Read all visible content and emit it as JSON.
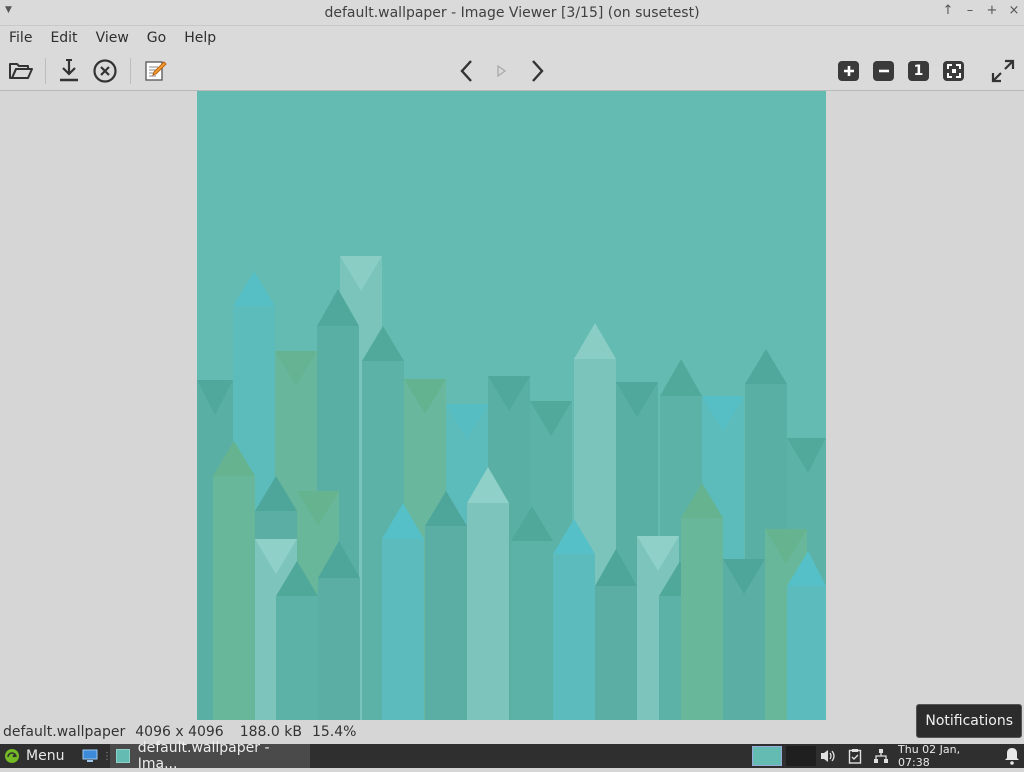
{
  "window": {
    "title": "default.wallpaper - Image Viewer [3/15] (on susetest)",
    "controls": {
      "pin": "↑",
      "minimize": "–",
      "maximize": "+",
      "close": "×"
    }
  },
  "menubar": {
    "items": [
      "File",
      "Edit",
      "View",
      "Go",
      "Help"
    ]
  },
  "toolbar": {
    "icons": [
      "folder-open-icon",
      "save-icon",
      "close-image-icon",
      "edit-icon",
      "previous-icon",
      "slideshow-icon",
      "next-icon",
      "zoom-in-icon",
      "zoom-out-icon",
      "zoom-original-icon",
      "zoom-fit-icon",
      "fullscreen-icon"
    ],
    "zoom_original_label": "1"
  },
  "image": {
    "background_color": "#64bbb2"
  },
  "statusbar": {
    "filename": "default.wallpaper",
    "dimensions": "4096 x 4096",
    "filesize": "188.0 kB",
    "zoom": "15.4%"
  },
  "notification_tooltip": "Notifications",
  "taskbar": {
    "menu_label": "Menu",
    "task_label": "default.wallpaper - Ima...",
    "clock": "Thu 02 Jan, 07:38"
  },
  "colors": {
    "accent": "#64bbb2",
    "taskbar": "#2f2f2f",
    "tooltip": "#2c2c2c"
  }
}
